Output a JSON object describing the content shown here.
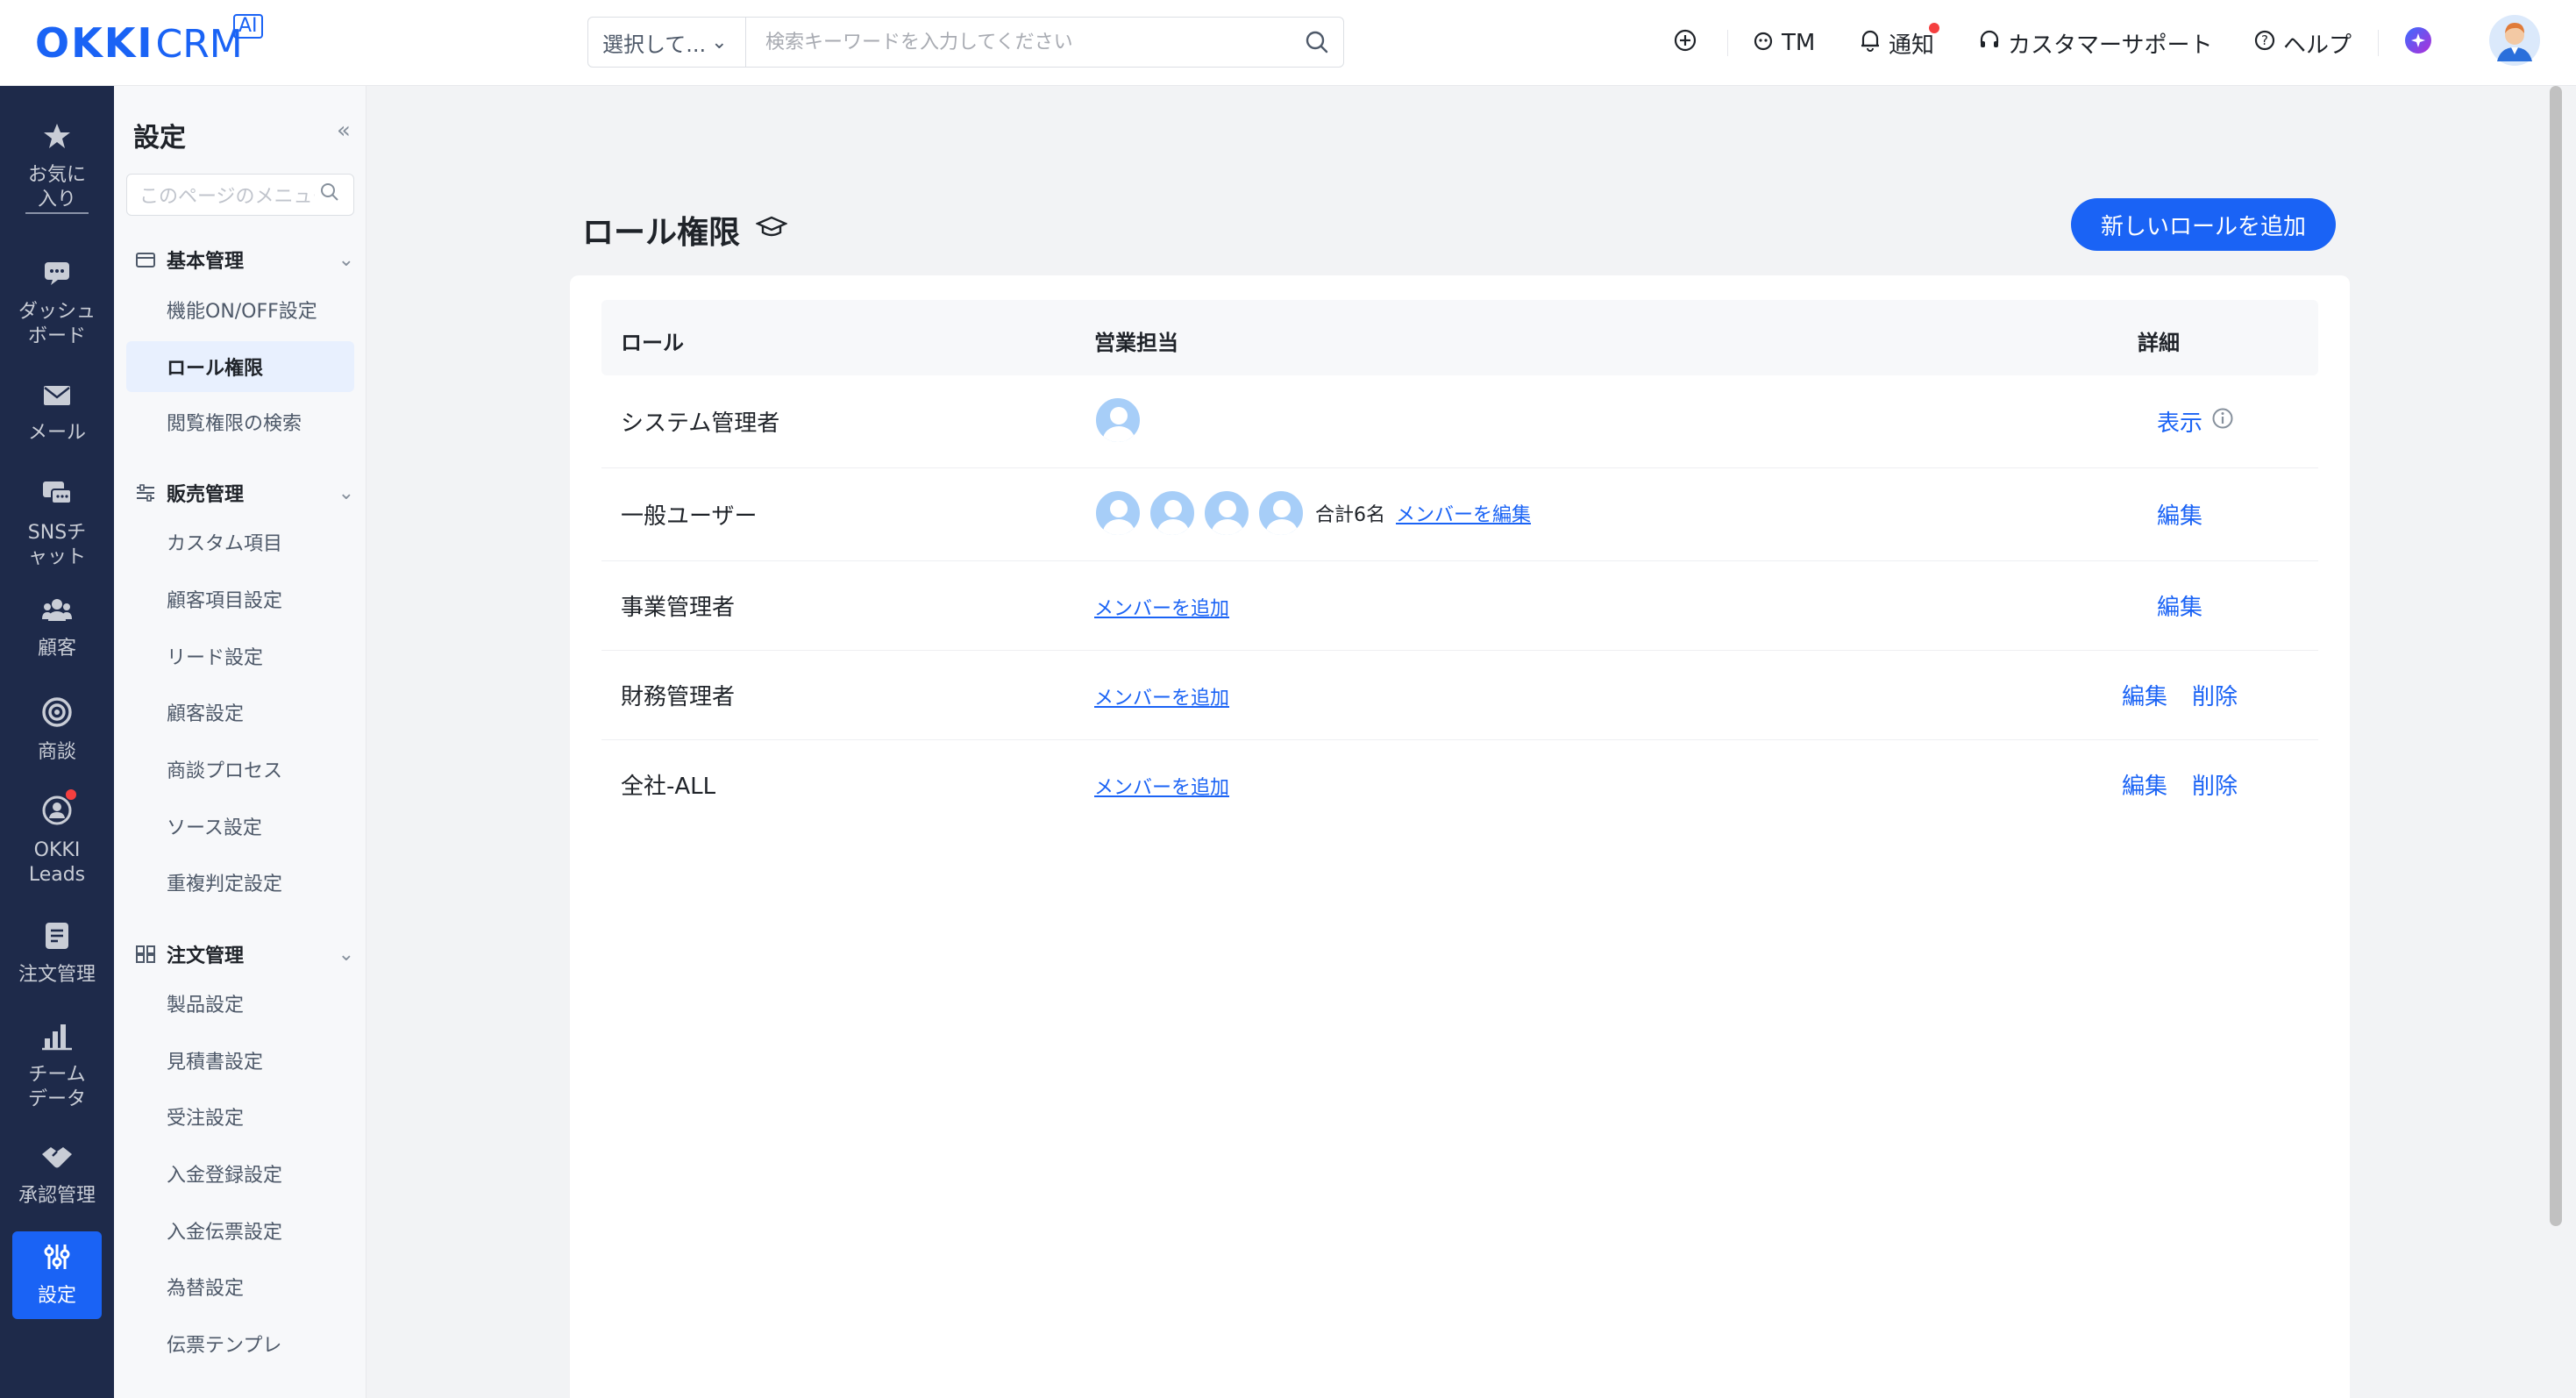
{
  "header": {
    "logo_brand": "OKKI",
    "logo_product": "CRM",
    "logo_ai": "AI",
    "search_select": "選択して...",
    "search_placeholder": "検索キーワードを入力してください",
    "tm": "TM",
    "notify": "通知",
    "support": "カスタマーサポート",
    "help": "ヘルプ"
  },
  "rail": {
    "items": [
      {
        "label": "お気に入り",
        "icon": "star-icon"
      },
      {
        "label": "ダッシュボード",
        "icon": "dashboard-icon"
      },
      {
        "label": "メール",
        "icon": "mail-icon"
      },
      {
        "label": "SNSチャット",
        "icon": "chat-icon"
      },
      {
        "label": "顧客",
        "icon": "customers-icon"
      },
      {
        "label": "商談",
        "icon": "target-icon"
      },
      {
        "label": "OKKI Leads",
        "icon": "leads-icon"
      },
      {
        "label": "注文管理",
        "icon": "order-icon"
      },
      {
        "label": "チームデータ",
        "icon": "chart-icon"
      },
      {
        "label": "承認管理",
        "icon": "handshake-icon"
      },
      {
        "label": "設定",
        "icon": "settings-sliders-icon"
      }
    ]
  },
  "submenu": {
    "title": "設定",
    "filter_placeholder": "このページのメニュー",
    "groups": [
      {
        "label": "基本管理",
        "items": [
          "機能ON/OFF設定",
          "ロール権限",
          "閲覧権限の検索"
        ]
      },
      {
        "label": "販売管理",
        "items": [
          "カスタム項目",
          "顧客項目設定",
          "リード設定",
          "顧客設定",
          "商談プロセス",
          "ソース設定",
          "重複判定設定"
        ]
      },
      {
        "label": "注文管理",
        "items": [
          "製品設定",
          "見積書設定",
          "受注設定",
          "入金登録設定",
          "入金伝票設定",
          "為替設定",
          "伝票テンプレ"
        ]
      }
    ]
  },
  "main": {
    "title": "ロール権限",
    "add_button": "新しいロールを追加",
    "columns": {
      "role": "ロール",
      "sales": "営業担当",
      "detail": "詳細"
    },
    "rows": [
      {
        "role": "システム管理者",
        "action1": "表示"
      },
      {
        "role": "一般ユーザー",
        "total": "合計6名",
        "edit_members": "メンバーを編集",
        "action1": "編集"
      },
      {
        "role": "事業管理者",
        "add_member": "メンバーを追加",
        "action1": "編集"
      },
      {
        "role": "財務管理者",
        "add_member": "メンバーを追加",
        "action1": "編集",
        "action2": "削除"
      },
      {
        "role": "全社-ALL",
        "add_member": "メンバーを追加",
        "action1": "編集",
        "action2": "削除"
      }
    ]
  },
  "colors": {
    "accent": "#1a63f5",
    "rail_bg": "#1e2a4a",
    "badge": "#f53f3f"
  }
}
